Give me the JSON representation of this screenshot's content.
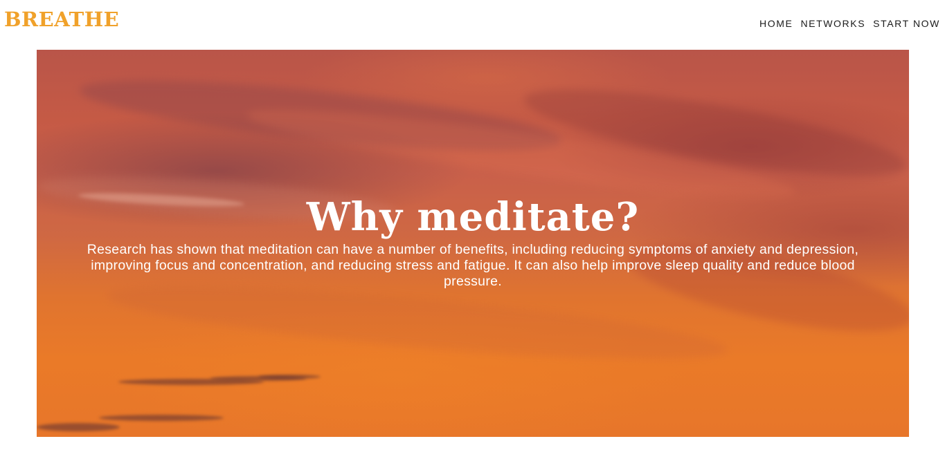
{
  "brand": {
    "name": "BREATHE",
    "color": "#f0a12a"
  },
  "nav": {
    "items": [
      {
        "label": "HOME"
      },
      {
        "label": "NETWORKS"
      },
      {
        "label": "START NOW"
      }
    ]
  },
  "hero": {
    "title": "Why meditate?",
    "body": "Research has shown that meditation can have a number of benefits, including reducing symptoms of anxiety and depression, improving focus and concentration, and reducing stress and fatigue. It can also help improve sleep quality and reduce blood pressure.",
    "background_image": "orange-sunset-sky"
  }
}
